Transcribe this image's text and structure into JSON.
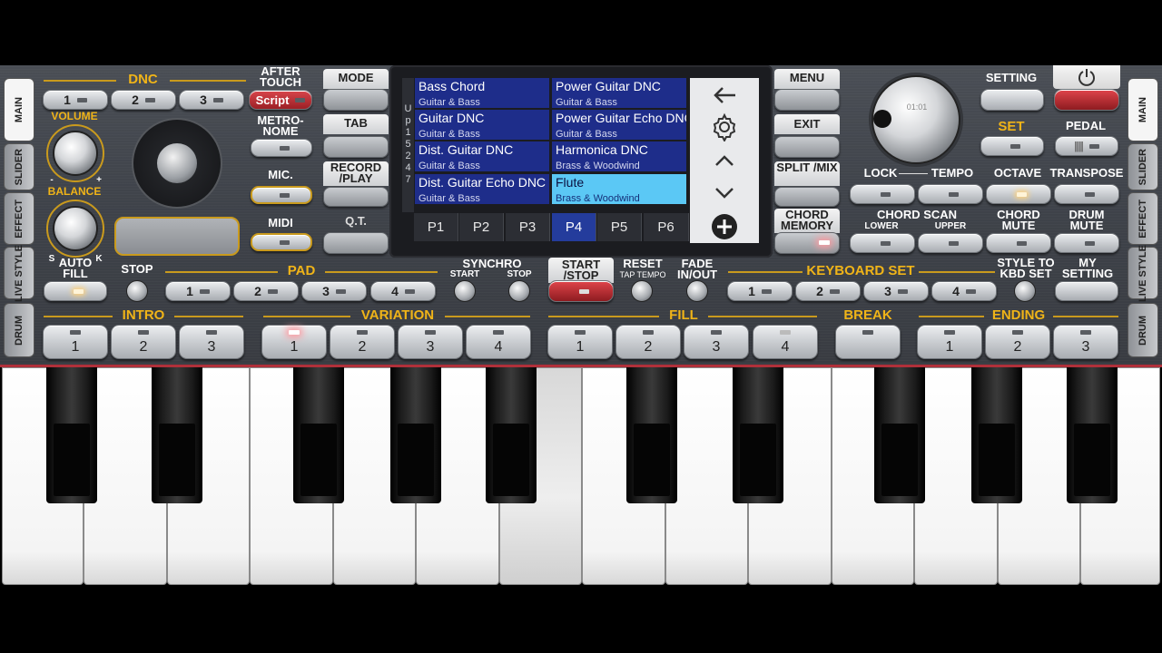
{
  "side_tabs": [
    "MAIN",
    "SLIDER",
    "EFFECT",
    "LIVE STYLE",
    "DRUM"
  ],
  "dnc": {
    "label": "DNC",
    "buttons": [
      "1",
      "2",
      "3"
    ],
    "script": "Script"
  },
  "after_touch": "AFTER TOUCH",
  "volume": "VOLUME",
  "balance": "BALANCE",
  "balance_marks": {
    "minus": "-",
    "plus": "+",
    "s": "S",
    "k": "K"
  },
  "metronome": "METRO- NOME",
  "mic": "MIC.",
  "midi": "MIDI",
  "mode": "MODE",
  "tab": "TAB",
  "record_play": "RECORD /PLAY",
  "qt": "Q.T.",
  "menu": "MENU",
  "exit": "EXIT",
  "split_mix": "SPLIT /MIX",
  "chord_memory": "CHORD MEMORY",
  "screen": {
    "side_letters": [
      "U",
      "p",
      "1",
      "5",
      "2",
      "4",
      "7"
    ],
    "styles": [
      {
        "name": "Bass Chord",
        "cat": "Guitar & Bass"
      },
      {
        "name": "Power Guitar DNC",
        "cat": "Guitar & Bass"
      },
      {
        "name": "Guitar DNC",
        "cat": "Guitar & Bass"
      },
      {
        "name": "Power Guitar Echo DNC",
        "cat": "Guitar & Bass"
      },
      {
        "name": "Dist. Guitar DNC",
        "cat": "Guitar & Bass"
      },
      {
        "name": "Harmonica DNC",
        "cat": "Brass & Woodwind"
      },
      {
        "name": "Dist. Guitar Echo DNC",
        "cat": "Guitar & Bass"
      },
      {
        "name": "Flute",
        "cat": "Brass & Woodwind"
      }
    ],
    "selected_style": "Flute",
    "pages": [
      "P1",
      "P2",
      "P3",
      "P4",
      "P5",
      "P6"
    ],
    "selected_page": "P4",
    "icons": [
      "back-arrow-icon",
      "settings-gear-icon",
      "chevron-up-icon",
      "chevron-down-icon",
      "plus-circle-icon"
    ]
  },
  "dial_readout": "01:01",
  "setting": "SETTING",
  "set": "SET",
  "pedal": "PEDAL",
  "lock": "LOCK",
  "tempo": "TEMPO",
  "octave": "OCTAVE",
  "transpose": "TRANSPOSE",
  "chord_scan": "CHORD SCAN",
  "lower": "LOWER",
  "upper": "UPPER",
  "chord_mute": "CHORD MUTE",
  "drum_mute": "DRUM MUTE",
  "auto_fill": "AUTO FILL",
  "stop": "STOP",
  "pad": {
    "label": "PAD",
    "buttons": [
      "1",
      "2",
      "3",
      "4"
    ]
  },
  "synchro": {
    "label": "SYNCHRO",
    "start": "START",
    "stop": "STOP"
  },
  "start_stop": "START /STOP",
  "reset": "RESET",
  "tap_tempo": "TAP TEMPO",
  "fade": "FADE IN/OUT",
  "keyboard_set": {
    "label": "KEYBOARD SET",
    "buttons": [
      "1",
      "2",
      "3",
      "4"
    ]
  },
  "style_to_kbd": "STYLE TO KBD SET",
  "my_setting": "MY SETTING",
  "intro": {
    "label": "INTRO",
    "buttons": [
      "1",
      "2",
      "3"
    ]
  },
  "variation": {
    "label": "VARIATION",
    "buttons": [
      "1",
      "2",
      "3",
      "4"
    ],
    "active": "1"
  },
  "fill": {
    "label": "FILL",
    "buttons": [
      "1",
      "2",
      "3",
      "4"
    ]
  },
  "break": "BREAK",
  "ending": {
    "label": "ENDING",
    "buttons": [
      "1",
      "2",
      "3"
    ]
  },
  "colors": {
    "gold": "#f0b418",
    "accent_red": "#c0282c",
    "screen_blue": "#1e2d8a",
    "screen_select": "#5bc8f5"
  }
}
